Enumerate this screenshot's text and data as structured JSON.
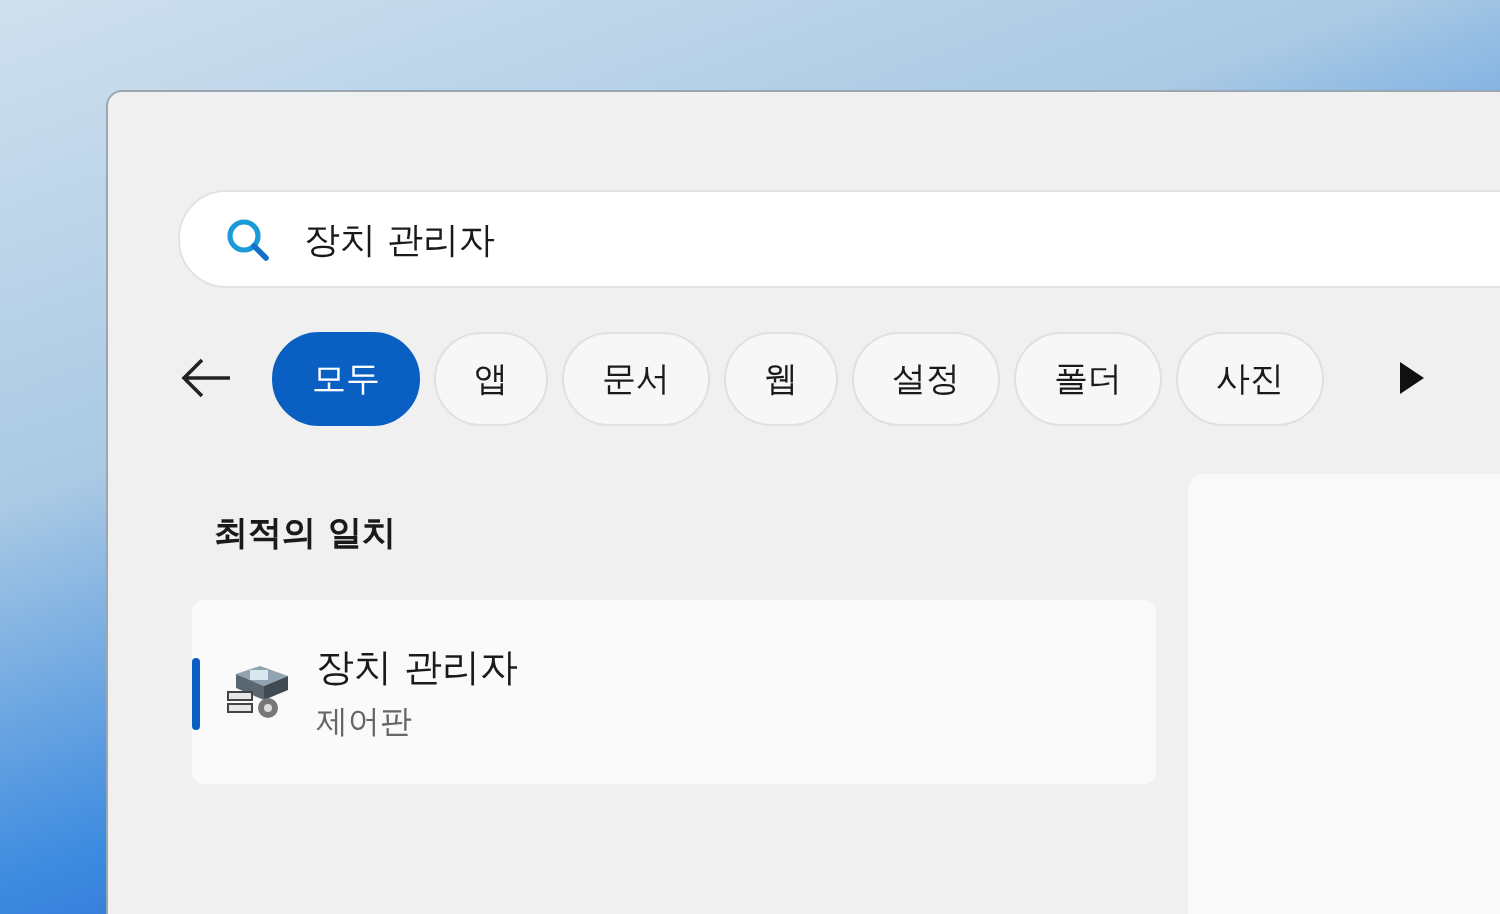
{
  "search": {
    "value": "장치 관리자"
  },
  "filters": [
    {
      "label": "모두",
      "selected": true
    },
    {
      "label": "앱",
      "selected": false
    },
    {
      "label": "문서",
      "selected": false
    },
    {
      "label": "웹",
      "selected": false
    },
    {
      "label": "설정",
      "selected": false
    },
    {
      "label": "폴더",
      "selected": false
    },
    {
      "label": "사진",
      "selected": false
    }
  ],
  "best_match": {
    "heading": "최적의 일치",
    "results": [
      {
        "title": "장치 관리자",
        "subtitle": "제어판",
        "selected": true
      }
    ]
  }
}
